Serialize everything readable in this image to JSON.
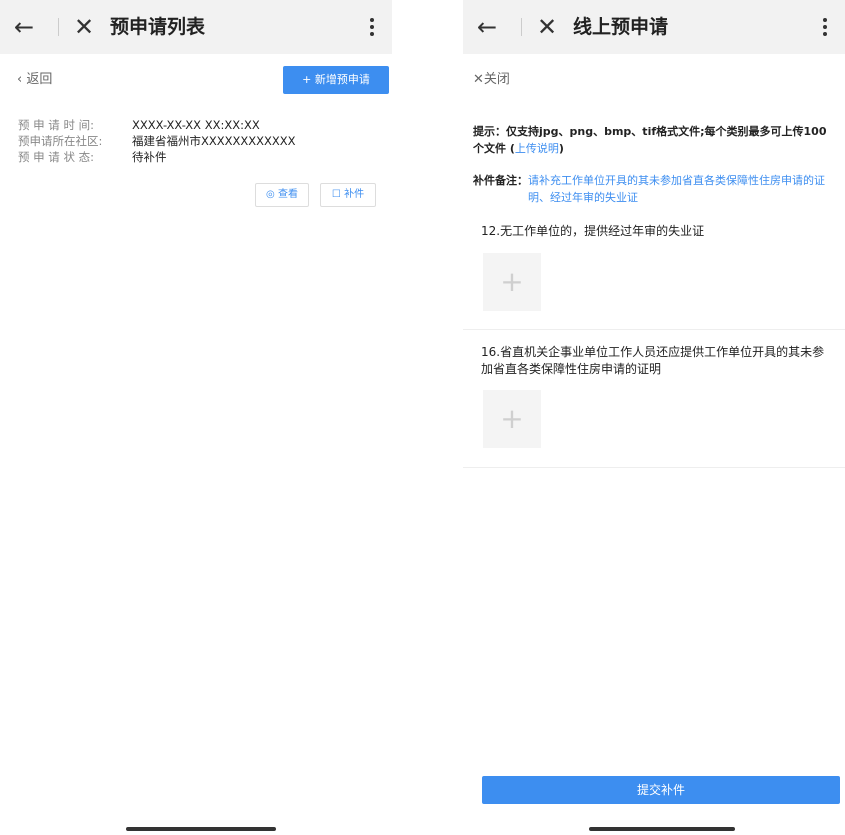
{
  "left": {
    "title": "预申请列表",
    "back_link": "返回",
    "new_button": "+ 新增预申请",
    "fields": [
      {
        "label": "预 申 请 时 间:",
        "value": "XXXX-XX-XX XX:XX:XX"
      },
      {
        "label": "预申请所在社区:",
        "value": "福建省福州市XXXXXXXXXXXX"
      },
      {
        "label": "预 申 请 状 态:",
        "value": "待补件"
      }
    ],
    "view_button": "查看",
    "supplement_button": "补件"
  },
  "right": {
    "title": "线上预申请",
    "close_link": "关闭",
    "tip_text": "提示：仅支持jpg、png、bmp、tif格式文件;每个类别最多可上传100个文件",
    "tip_link": "上传说明",
    "remark_label": "补件备注：",
    "remark_text": "请补充工作单位开具的其未参加省直各类保障性住房申请的证明、经过年审的失业证",
    "section1": "12.无工作单位的，提供经过年审的失业证",
    "section2": "16.省直机关企事业单位工作人员还应提供工作单位开具的其未参加省直各类保障性住房申请的证明",
    "submit_button": "提交补件"
  },
  "icons": {
    "back": "arrow-left-icon",
    "close": "close-x-icon",
    "more": "kebab-menu-icon",
    "plus": "plus-icon",
    "eye": "eye-icon",
    "edit": "edit-icon"
  },
  "colors": {
    "accent": "#3d8ef0",
    "header": "#f2f2f2"
  }
}
